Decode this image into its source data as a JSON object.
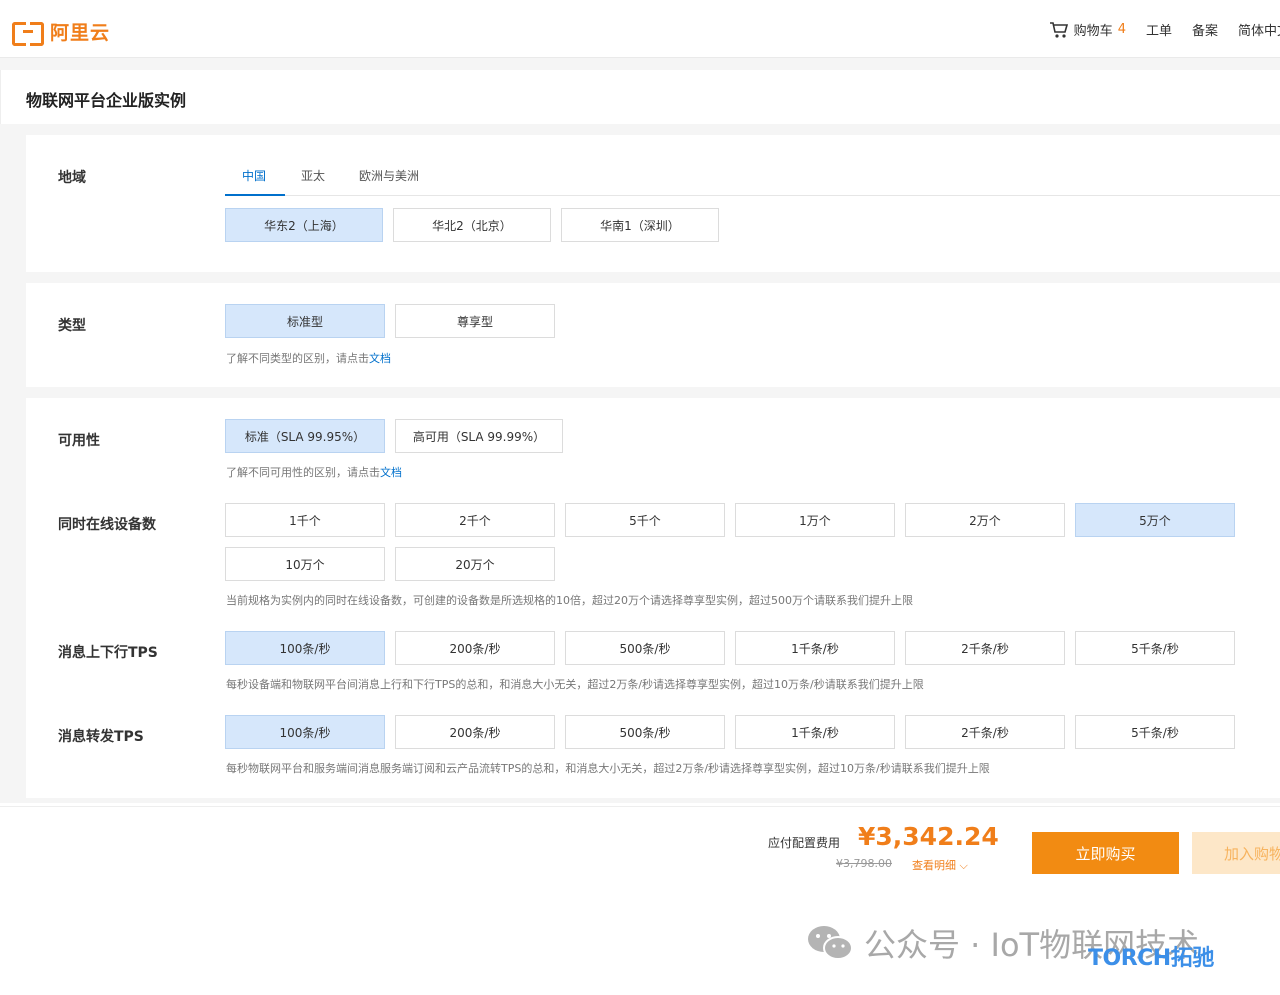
{
  "nav": {
    "brand": "阿里云",
    "cart_label": "购物车",
    "cart_count": "4",
    "links": [
      "工单",
      "备案",
      "简体中文"
    ]
  },
  "page": {
    "title": "物联网平台企业版实例"
  },
  "region": {
    "label": "地域",
    "tabs": [
      "中国",
      "亚太",
      "欧洲与美洲"
    ],
    "options": [
      "华东2（上海）",
      "华北2（北京）",
      "华南1（深圳）"
    ],
    "selected": "华东2（上海）"
  },
  "type": {
    "label": "类型",
    "options": [
      "标准型",
      "尊享型"
    ],
    "selected": "标准型",
    "hint": "了解不同类型的区别，请点击",
    "hint_link": "文档"
  },
  "availability": {
    "label": "可用性",
    "options": [
      "标准（SLA 99.95%）",
      "高可用（SLA 99.99%）"
    ],
    "selected": "标准（SLA 99.95%）",
    "hint": "了解不同可用性的区别，请点击",
    "hint_link": "文档"
  },
  "devices": {
    "label": "同时在线设备数",
    "options": [
      "1千个",
      "2千个",
      "5千个",
      "1万个",
      "2万个",
      "5万个",
      "10万个",
      "20万个"
    ],
    "selected": "5万个",
    "hint": "当前规格为实例内的同时在线设备数，可创建的设备数是所选规格的10倍，超过20万个请选择尊享型实例，超过500万个请联系我们提升上限"
  },
  "msg_tps": {
    "label": "消息上下行TPS",
    "options": [
      "100条/秒",
      "200条/秒",
      "500条/秒",
      "1千条/秒",
      "2千条/秒",
      "5千条/秒"
    ],
    "selected": "100条/秒",
    "hint": "每秒设备端和物联网平台间消息上行和下行TPS的总和，和消息大小无关，超过2万条/秒请选择尊享型实例，超过10万条/秒请联系我们提升上限"
  },
  "forward_tps": {
    "label": "消息转发TPS",
    "options": [
      "100条/秒",
      "200条/秒",
      "500条/秒",
      "1千条/秒",
      "2千条/秒",
      "5千条/秒"
    ],
    "selected": "100条/秒",
    "hint": "每秒物联网平台和服务端间消息服务端订阅和云产品流转TPS的总和，和消息大小无关，超过2万条/秒请选择尊享型实例，超过10万条/秒请联系我们提升上限"
  },
  "footer": {
    "price_label": "应付配置费用",
    "price": "¥3,342.24",
    "old_price": "¥3,798.00",
    "detail_link": "查看明细",
    "buy_button": "立即购买",
    "cart_button": "加入购物车"
  },
  "watermark": {
    "text": "公众号 · IoT物联网技术",
    "logo_text": "TORCH拓驰"
  },
  "colors": {
    "accent": "#f07e1a",
    "link": "#0070cc",
    "selected_bg": "#d6e7fb"
  }
}
